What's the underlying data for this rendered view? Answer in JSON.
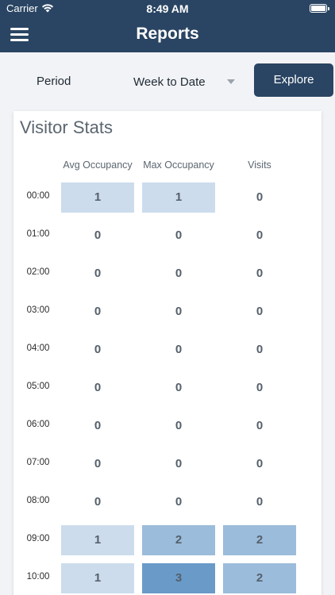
{
  "status_bar": {
    "carrier": "Carrier",
    "time": "8:49 AM"
  },
  "nav": {
    "title": "Reports",
    "menu_icon": "hamburger-menu-icon"
  },
  "filter": {
    "period_label": "Period",
    "period_value": "Week to Date",
    "explore_label": "Explore"
  },
  "card": {
    "title": "Visitor Stats",
    "columns": [
      "Avg Occupancy",
      "Max Occupancy",
      "Visits"
    ]
  },
  "rows": [
    {
      "time": "00:00",
      "avg": "1",
      "max": "1",
      "visits": "0"
    },
    {
      "time": "01:00",
      "avg": "0",
      "max": "0",
      "visits": "0"
    },
    {
      "time": "02:00",
      "avg": "0",
      "max": "0",
      "visits": "0"
    },
    {
      "time": "03:00",
      "avg": "0",
      "max": "0",
      "visits": "0"
    },
    {
      "time": "04:00",
      "avg": "0",
      "max": "0",
      "visits": "0"
    },
    {
      "time": "05:00",
      "avg": "0",
      "max": "0",
      "visits": "0"
    },
    {
      "time": "06:00",
      "avg": "0",
      "max": "0",
      "visits": "0"
    },
    {
      "time": "07:00",
      "avg": "0",
      "max": "0",
      "visits": "0"
    },
    {
      "time": "08:00",
      "avg": "0",
      "max": "0",
      "visits": "0"
    },
    {
      "time": "09:00",
      "avg": "1",
      "max": "2",
      "visits": "2"
    },
    {
      "time": "10:00",
      "avg": "1",
      "max": "3",
      "visits": "2"
    }
  ],
  "colors": {
    "header_bg": "#2a4563",
    "level_0": "transparent",
    "level_1": "#ccdcec",
    "level_2": "#9bbcdb",
    "level_3": "#6a9ac8"
  }
}
